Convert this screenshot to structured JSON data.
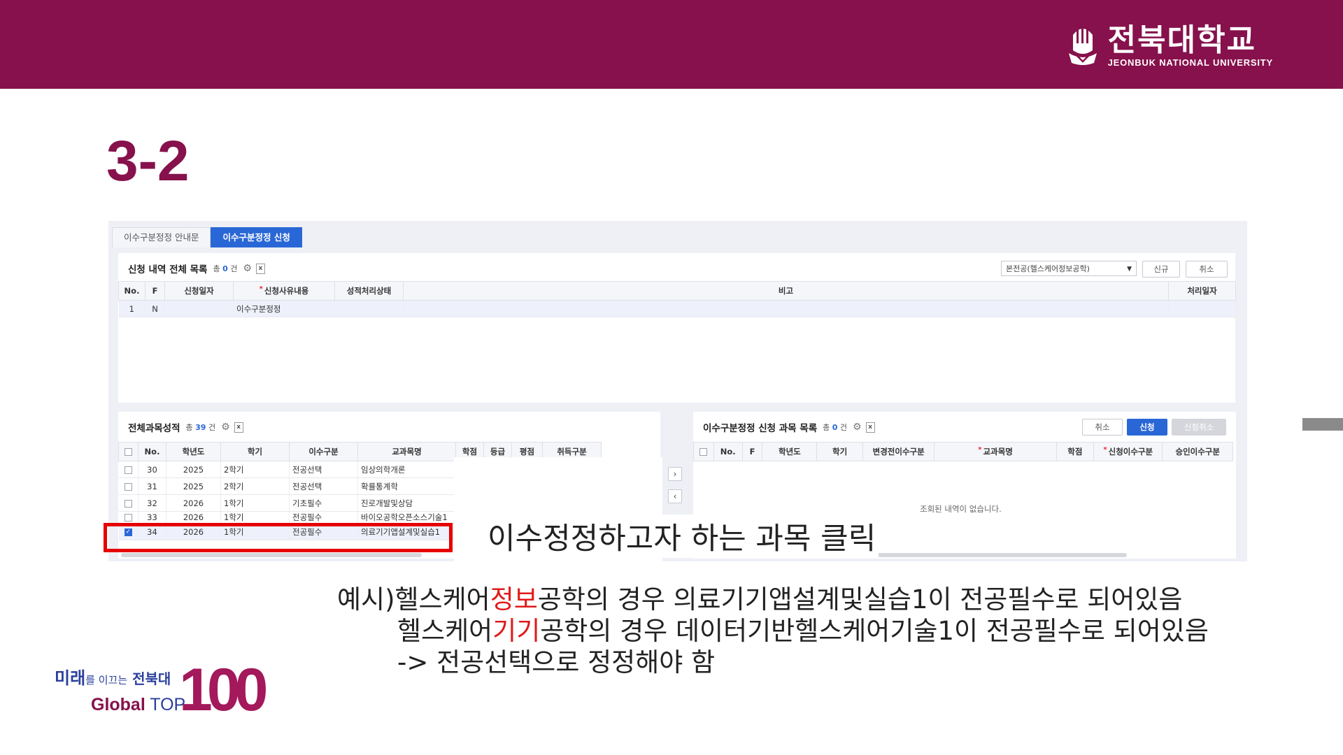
{
  "header": {
    "logo_kr": "전북대학교",
    "logo_en": "JEONBUK NATIONAL UNIVERSITY",
    "brand_color": "#86114c"
  },
  "slide": {
    "title": "3-2"
  },
  "tabs": [
    {
      "label": "이수구분정정 안내문",
      "active": false
    },
    {
      "label": "이수구분정정 신청",
      "active": true
    }
  ],
  "application_list": {
    "title": "신청 내역 전체 목록",
    "count_prefix": "총",
    "count": "0",
    "count_suffix": "건",
    "dropdown_value": "본전공(헬스케어정보공학)",
    "new_label": "신규",
    "cancel_label": "취소",
    "columns": [
      "No.",
      "F",
      "신청일자",
      "신청사유내용",
      "성적처리상태",
      "비고",
      "처리일자"
    ],
    "rows": [
      {
        "no": "1",
        "f": "N",
        "date": "",
        "reason": "이수구분정정",
        "status": "",
        "note": "",
        "processed": ""
      }
    ]
  },
  "all_grades": {
    "title": "전체과목성적",
    "count_prefix": "총",
    "count": "39",
    "count_suffix": "건",
    "columns": [
      "No.",
      "학년도",
      "학기",
      "이수구분",
      "교과목명",
      "학점",
      "등급",
      "평점",
      "취득구분"
    ],
    "rows": [
      {
        "no": "30",
        "year": "2025",
        "term": "2학기",
        "type": "전공선택",
        "course": "임상의학개론",
        "checked": false
      },
      {
        "no": "31",
        "year": "2025",
        "term": "2학기",
        "type": "전공선택",
        "course": "확률통계학",
        "checked": false
      },
      {
        "no": "32",
        "year": "2026",
        "term": "1학기",
        "type": "기초필수",
        "course": "진로개발및상담",
        "checked": false
      },
      {
        "no": "33",
        "year": "2026",
        "term": "1학기",
        "type": "전공필수",
        "course": "바이오공학오픈소스기술1",
        "checked": false
      },
      {
        "no": "34",
        "year": "2026",
        "term": "1학기",
        "type": "전공필수",
        "course": "의료기기앱설계및실습1",
        "checked": true
      }
    ]
  },
  "correction_list": {
    "title": "이수구분정정 신청 과목 목록",
    "count_prefix": "총",
    "count": "0",
    "count_suffix": "건",
    "cancel_label": "취소",
    "apply_label": "신청",
    "withdraw_label": "신청취소",
    "columns": [
      "No.",
      "F",
      "학년도",
      "학기",
      "변경전이수구분",
      "교과목명",
      "학점",
      "신청이수구분",
      "승인이수구분"
    ],
    "empty_message": "조회된 내역이 없습니다."
  },
  "transfer": {
    "right_arrow": "›",
    "left_arrow": "‹"
  },
  "callout": "이수정정하고자 하는 과목 클릭",
  "notes": {
    "line1_a": "예시)헬스케어",
    "line1_red": "정보",
    "line1_b": "공학의 경우 의료기기앱설계및실습1이 전공필수로 되어있음",
    "line2_a": "헬스케어",
    "line2_red": "기기",
    "line2_b": "공학의 경우 데이터기반헬스케어기술1이 전공필수로 되어있음",
    "line3": "-> 전공선택으로 정정해야 함"
  },
  "badge": {
    "line1_a": "미래",
    "line1_b": "를 이끄는",
    "line1_c": "전북대",
    "line2_a": "Global",
    "line2_b": "TOP",
    "number": "100"
  }
}
